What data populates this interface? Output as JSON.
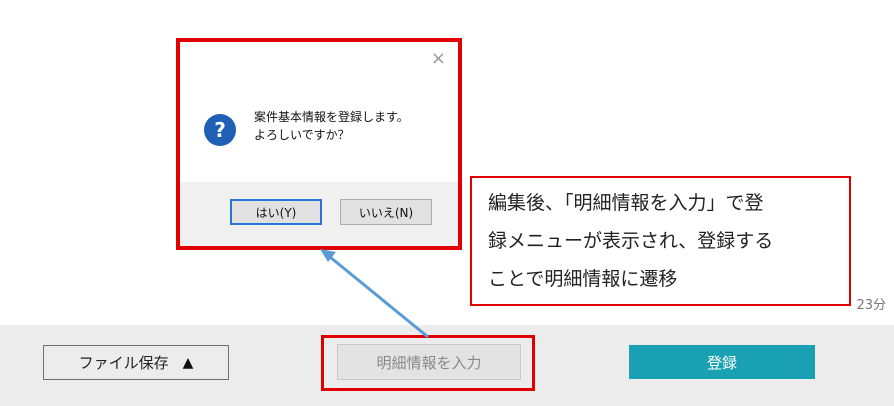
{
  "bottom_bar": {
    "file_save_label": "ファイル保存",
    "file_save_arrow": "▲",
    "detail_input_label": "明細情報を入力",
    "register_label": "登録",
    "register_color": "#1aa0b3"
  },
  "last_updated_tail": "23分",
  "dialog": {
    "close_glyph": "×",
    "icon_glyph": "?",
    "message_line1": "案件基本情報を登録します。",
    "message_line2": "よろしいですか？",
    "yes_label": "はい(Y)",
    "no_label": "いいえ(N)"
  },
  "callout": {
    "line1": "編集後、「明細情報を入力」で登",
    "line2": "録メニューが表示され、登録する",
    "line3": "ことで明細情報に遷移"
  },
  "annotation_color": "#e00000",
  "arrow_color": "#5b9bd5"
}
